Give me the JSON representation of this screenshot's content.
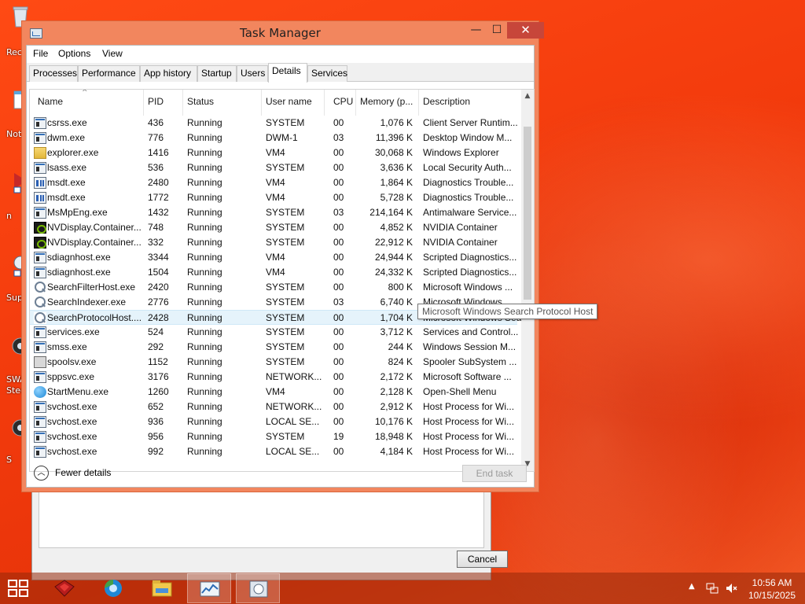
{
  "desktop": {
    "icons": [
      {
        "label": "Rec",
        "icon": "recycle-bin-icon"
      },
      {
        "label": "Not",
        "icon": "notepad-icon"
      },
      {
        "label": "n",
        "icon": "shortcut-icon"
      },
      {
        "label": "Sup",
        "icon": "support-icon"
      },
      {
        "label": "SWA",
        "label2": "Stec",
        "icon": "app-icon"
      },
      {
        "label": "S",
        "icon": "app-icon"
      }
    ]
  },
  "window": {
    "title": "Task Manager",
    "min": "—",
    "max": "☐",
    "close": "✕"
  },
  "menu": [
    "File",
    "Options",
    "View"
  ],
  "tabs": [
    "Processes",
    "Performance",
    "App history",
    "Startup",
    "Users",
    "Details",
    "Services"
  ],
  "active_tab": "Details",
  "columns": [
    "Name",
    "PID",
    "Status",
    "User name",
    "CPU",
    "Memory (p...",
    "Description"
  ],
  "processes": [
    {
      "icon": "win",
      "name": "csrss.exe",
      "pid": "436",
      "status": "Running",
      "user": "SYSTEM",
      "cpu": "00",
      "mem": "1,076 K",
      "desc": "Client Server Runtim..."
    },
    {
      "icon": "win",
      "name": "dwm.exe",
      "pid": "776",
      "status": "Running",
      "user": "DWM-1",
      "cpu": "03",
      "mem": "11,396 K",
      "desc": "Desktop Window M..."
    },
    {
      "icon": "folder",
      "name": "explorer.exe",
      "pid": "1416",
      "status": "Running",
      "user": "VM4",
      "cpu": "00",
      "mem": "30,068 K",
      "desc": "Windows Explorer"
    },
    {
      "icon": "win",
      "name": "lsass.exe",
      "pid": "536",
      "status": "Running",
      "user": "SYSTEM",
      "cpu": "00",
      "mem": "3,636 K",
      "desc": "Local Security Auth..."
    },
    {
      "icon": "diag",
      "name": "msdt.exe",
      "pid": "2480",
      "status": "Running",
      "user": "VM4",
      "cpu": "00",
      "mem": "1,864 K",
      "desc": "Diagnostics Trouble..."
    },
    {
      "icon": "diag",
      "name": "msdt.exe",
      "pid": "1772",
      "status": "Running",
      "user": "VM4",
      "cpu": "00",
      "mem": "5,728 K",
      "desc": "Diagnostics Trouble..."
    },
    {
      "icon": "win",
      "name": "MsMpEng.exe",
      "pid": "1432",
      "status": "Running",
      "user": "SYSTEM",
      "cpu": "03",
      "mem": "214,164 K",
      "desc": "Antimalware Service..."
    },
    {
      "icon": "nv",
      "name": "NVDisplay.Container...",
      "pid": "748",
      "status": "Running",
      "user": "SYSTEM",
      "cpu": "00",
      "mem": "4,852 K",
      "desc": "NVIDIA Container"
    },
    {
      "icon": "nv",
      "name": "NVDisplay.Container...",
      "pid": "332",
      "status": "Running",
      "user": "SYSTEM",
      "cpu": "00",
      "mem": "22,912 K",
      "desc": "NVIDIA Container"
    },
    {
      "icon": "win",
      "name": "sdiagnhost.exe",
      "pid": "3344",
      "status": "Running",
      "user": "VM4",
      "cpu": "00",
      "mem": "24,944 K",
      "desc": "Scripted Diagnostics..."
    },
    {
      "icon": "win",
      "name": "sdiagnhost.exe",
      "pid": "1504",
      "status": "Running",
      "user": "VM4",
      "cpu": "00",
      "mem": "24,332 K",
      "desc": "Scripted Diagnostics..."
    },
    {
      "icon": "search",
      "name": "SearchFilterHost.exe",
      "pid": "2420",
      "status": "Running",
      "user": "SYSTEM",
      "cpu": "00",
      "mem": "800 K",
      "desc": "Microsoft Windows ..."
    },
    {
      "icon": "search",
      "name": "SearchIndexer.exe",
      "pid": "2776",
      "status": "Running",
      "user": "SYSTEM",
      "cpu": "03",
      "mem": "6,740 K",
      "desc": "Microsoft Windows ..."
    },
    {
      "icon": "search",
      "name": "SearchProtocolHost....",
      "pid": "2428",
      "status": "Running",
      "user": "SYSTEM",
      "cpu": "00",
      "mem": "1,704 K",
      "desc": "Microsoft Windows Search Protocol Host",
      "selected": true
    },
    {
      "icon": "win",
      "name": "services.exe",
      "pid": "524",
      "status": "Running",
      "user": "SYSTEM",
      "cpu": "00",
      "mem": "3,712 K",
      "desc": "Services and Control..."
    },
    {
      "icon": "win",
      "name": "smss.exe",
      "pid": "292",
      "status": "Running",
      "user": "SYSTEM",
      "cpu": "00",
      "mem": "244 K",
      "desc": "Windows Session M..."
    },
    {
      "icon": "print",
      "name": "spoolsv.exe",
      "pid": "1152",
      "status": "Running",
      "user": "SYSTEM",
      "cpu": "00",
      "mem": "824 K",
      "desc": "Spooler SubSystem ..."
    },
    {
      "icon": "win",
      "name": "sppsvc.exe",
      "pid": "3176",
      "status": "Running",
      "user": "NETWORK...",
      "cpu": "00",
      "mem": "2,172 K",
      "desc": "Microsoft Software ..."
    },
    {
      "icon": "globe",
      "name": "StartMenu.exe",
      "pid": "1260",
      "status": "Running",
      "user": "VM4",
      "cpu": "00",
      "mem": "2,128 K",
      "desc": "Open-Shell Menu"
    },
    {
      "icon": "win",
      "name": "svchost.exe",
      "pid": "652",
      "status": "Running",
      "user": "NETWORK...",
      "cpu": "00",
      "mem": "2,912 K",
      "desc": "Host Process for Wi..."
    },
    {
      "icon": "win",
      "name": "svchost.exe",
      "pid": "936",
      "status": "Running",
      "user": "LOCAL SE...",
      "cpu": "00",
      "mem": "10,176 K",
      "desc": "Host Process for Wi..."
    },
    {
      "icon": "win",
      "name": "svchost.exe",
      "pid": "956",
      "status": "Running",
      "user": "SYSTEM",
      "cpu": "19",
      "mem": "18,948 K",
      "desc": "Host Process for Wi..."
    },
    {
      "icon": "win",
      "name": "svchost.exe",
      "pid": "992",
      "status": "Running",
      "user": "LOCAL SE...",
      "cpu": "00",
      "mem": "4,184 K",
      "desc": "Host Process for Wi..."
    }
  ],
  "tooltip": "Microsoft Windows Search Protocol Host",
  "footer": {
    "fewer_details": "Fewer details",
    "end_task": "End task"
  },
  "bg_dialog": {
    "cancel": "Cancel"
  },
  "taskbar": {
    "time": "10:56 AM",
    "date": "10/15/2025",
    "items": [
      "app-red-icon",
      "browser-icon",
      "file-explorer-icon",
      "task-manager-icon",
      "troubleshooter-icon"
    ]
  }
}
